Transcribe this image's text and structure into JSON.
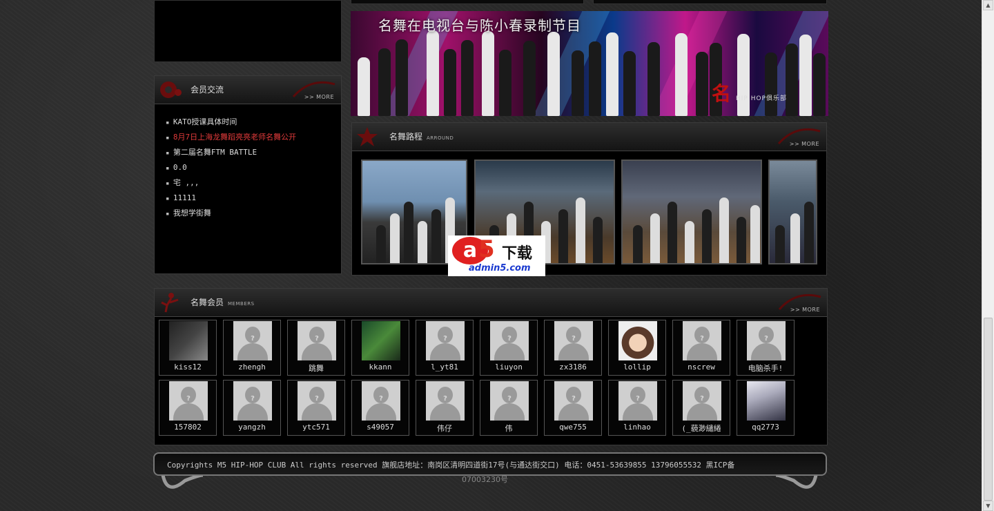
{
  "colors": {
    "accent_red": "#e03a3a",
    "panel_bg": "#000000",
    "page_bg": "#2a2a2a"
  },
  "members_panel": {
    "title": "会员交流",
    "more": ">> MORE",
    "posts": [
      {
        "text": "KATO授课具体时间",
        "hot": false
      },
      {
        "text": "8月7日上海龙舞蹈亮亮老师名舞公开",
        "hot": true
      },
      {
        "text": "第二届名舞FTM BATTLE",
        "hot": false
      },
      {
        "text": "0.0",
        "hot": false
      },
      {
        "text": "宅 ,,,",
        "hot": false
      },
      {
        "text": "11111",
        "hot": false
      },
      {
        "text": "我想学街舞",
        "hot": false
      }
    ]
  },
  "banner": {
    "title": "名舞在电视台与陈小春录制节目",
    "logo_mark": "名",
    "logo_text": "HIP HOP俱乐部"
  },
  "tour_panel": {
    "title": "名舞路程",
    "subtitle": "ARROUND",
    "more": ">> MORE"
  },
  "watermark": {
    "brand": "a",
    "five": "5",
    "xiazai": "下载",
    "url": "admin5.com"
  },
  "members_grid": {
    "title": "名舞会员",
    "subtitle": "MEMBERS",
    "more": ">> MORE",
    "row1": [
      {
        "name": "kiss12",
        "avatar": "photo-a"
      },
      {
        "name": "zhengh",
        "avatar": "default"
      },
      {
        "name": "跳舞",
        "avatar": "default"
      },
      {
        "name": "kkann",
        "avatar": "photo-b"
      },
      {
        "name": "l_yt81",
        "avatar": "default"
      },
      {
        "name": "liuyon",
        "avatar": "default"
      },
      {
        "name": "zx3186",
        "avatar": "default"
      },
      {
        "name": "lollip",
        "avatar": "photo-c"
      },
      {
        "name": "nscrew",
        "avatar": "default"
      },
      {
        "name": "电脑杀手!",
        "avatar": "default"
      }
    ],
    "row2": [
      {
        "name": "157802",
        "avatar": "default"
      },
      {
        "name": "yangzh",
        "avatar": "default"
      },
      {
        "name": "ytc571",
        "avatar": "default"
      },
      {
        "name": "s49057",
        "avatar": "default"
      },
      {
        "name": "伟仔",
        "avatar": "default"
      },
      {
        "name": "伟",
        "avatar": "default"
      },
      {
        "name": "qwe755",
        "avatar": "default"
      },
      {
        "name": "linhao",
        "avatar": "default"
      },
      {
        "name": "(_藐渺繾綣",
        "avatar": "default"
      },
      {
        "name": "qq2773",
        "avatar": "photo-d"
      }
    ]
  },
  "footer": {
    "text": "Copyrights M5 HIP-HOP CLUB All rights reserved  旗舰店地址：南岗区清明四道街17号(与通达街交口) 电话：0451-53639855  13796055532   黑ICP备",
    "icp_tail": "07003230号"
  }
}
